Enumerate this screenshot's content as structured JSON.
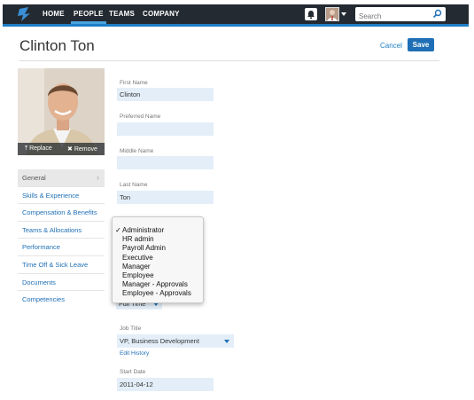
{
  "nav": {
    "items": [
      "HOME",
      "PEOPLE",
      "TEAMS",
      "COMPANY"
    ],
    "active_index": 1,
    "search_placeholder": "Search",
    "accent": "#1f7dc4"
  },
  "header": {
    "title": "Clinton Ton",
    "cancel_label": "Cancel",
    "save_label": "Save"
  },
  "photo": {
    "replace_label": "Replace",
    "remove_label": "Remove"
  },
  "side_menu": {
    "items": [
      "General",
      "Skills & Experience",
      "Compensation & Benefits",
      "Teams & Allocations",
      "Performance",
      "Time Off & Sick Leave",
      "Documents",
      "Competencies"
    ],
    "active_index": 0
  },
  "form": {
    "first_name": {
      "label": "First Name",
      "value": "Clinton"
    },
    "preferred_name": {
      "label": "Preferred Name",
      "value": ""
    },
    "middle_name": {
      "label": "Middle Name",
      "value": ""
    },
    "last_name": {
      "label": "Last Name",
      "value": "Ton"
    },
    "employment_type": {
      "value": "Full Time"
    },
    "job_title": {
      "label": "Job Title",
      "value": "VP, Business Development",
      "edit_history": "Edit History"
    },
    "start_date": {
      "label": "Start Date",
      "value": "2011-04-12"
    }
  },
  "role_dropdown": {
    "options": [
      "Administrator",
      "HR admin",
      "Payroll Admin",
      "Executive",
      "Manager",
      "Employee",
      "Manager - Approvals",
      "Employee - Approvals"
    ],
    "selected": "Administrator"
  }
}
